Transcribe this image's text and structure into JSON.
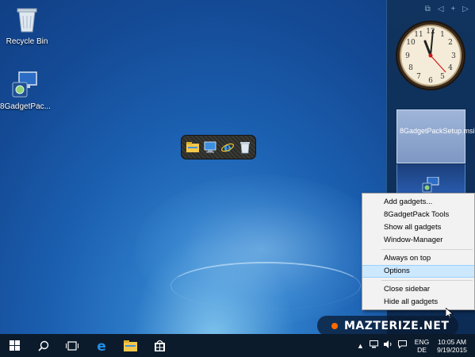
{
  "desktop": {
    "icons": [
      {
        "label": "Recycle Bin",
        "icon": "recycle-bin-icon"
      },
      {
        "label": "8GadgetPac...",
        "icon": "installer-icon"
      }
    ]
  },
  "gadget_launcher": {
    "items": [
      "file-explorer-icon",
      "computer-icon",
      "internet-explorer-icon",
      "recycle-bin-icon"
    ]
  },
  "sidebar": {
    "controls": [
      "⧉",
      "◁",
      "+",
      "▷"
    ],
    "file_gadget": {
      "filename": "8GadgetPackSetup.msi"
    }
  },
  "context_menu": {
    "items": [
      {
        "label": "Add gadgets..."
      },
      {
        "label": "8GadgetPack Tools"
      },
      {
        "label": "Show all gadgets"
      },
      {
        "label": "Window-Manager"
      },
      {
        "label": "Always on top"
      },
      {
        "label": "Options",
        "highlighted": true
      },
      {
        "label": "Close sidebar"
      },
      {
        "label": "Hide all gadgets"
      }
    ]
  },
  "watermark": {
    "text": "MAZTERIZE.NET"
  },
  "taskbar": {
    "buttons": [
      "start-icon",
      "search-icon",
      "task-view-icon",
      "edge-icon",
      "file-explorer-icon",
      "store-icon"
    ],
    "tray": {
      "language_top": "ENG",
      "language_bottom": "DE",
      "time": "10:05 AM",
      "date": "9/19/2015"
    }
  },
  "colors": {
    "desktop_dark": "#0f3b7e",
    "desktop_light": "#7fc4ee",
    "taskbar": "#0c1b2c",
    "menu_highlight": "#cce8ff",
    "watermark_dot": "#ff6a00"
  }
}
